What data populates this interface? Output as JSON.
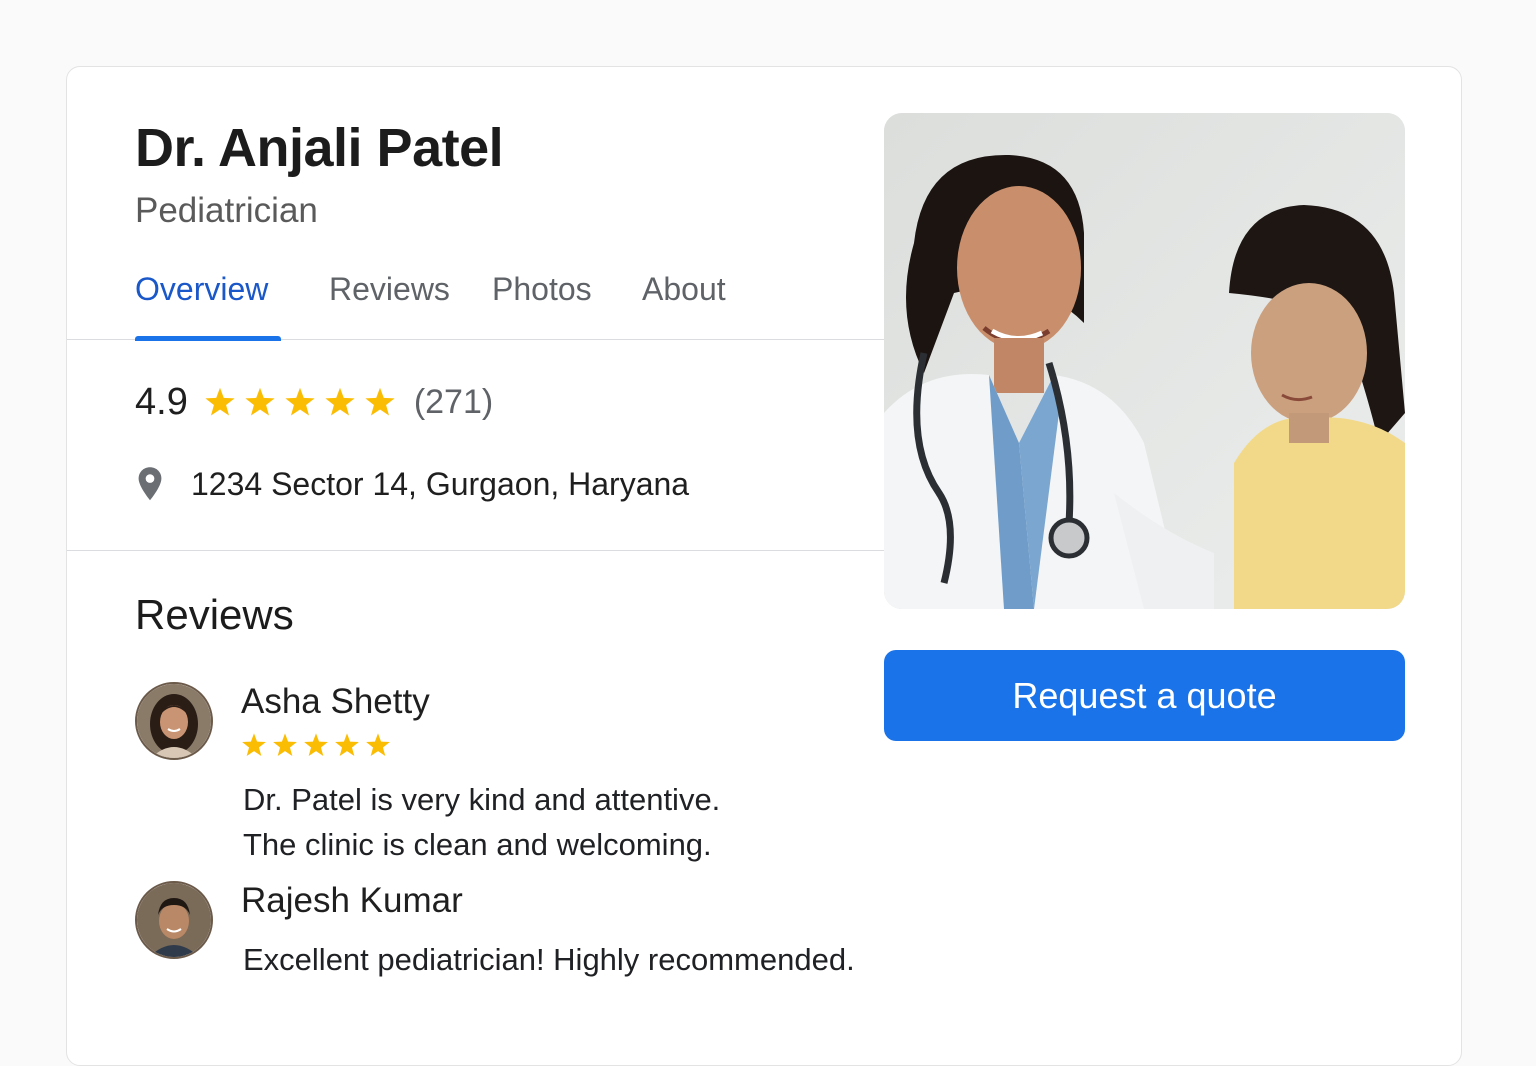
{
  "profile": {
    "name": "Dr. Anjali Patel",
    "specialty": "Pediatrician"
  },
  "tabs": [
    {
      "label": "Overview",
      "active": true
    },
    {
      "label": "Reviews",
      "active": false
    },
    {
      "label": "Photos",
      "active": false
    },
    {
      "label": "About",
      "active": false
    }
  ],
  "rating": {
    "value": "4.9",
    "stars": 5,
    "count": "(271)"
  },
  "location": {
    "icon": "location-pin-icon",
    "address": "1234 Sector 14, Gurgaon, Haryana"
  },
  "reviews_section": {
    "heading": "Reviews",
    "items": [
      {
        "name": "Asha Shetty",
        "stars": 5,
        "text_lines": [
          "Dr. Patel is very kind and attentive.",
          "The clinic is clean and welcoming."
        ]
      },
      {
        "name": "Rajesh Kumar",
        "text_lines": [
          "Excellent pediatrician! Highly recommended."
        ]
      }
    ]
  },
  "cta": {
    "label": "Request a quote"
  },
  "colors": {
    "accent": "#1a73e8",
    "star": "#fbbc04",
    "active_tab_text": "#1a57c9",
    "muted_text": "#5f6368"
  }
}
